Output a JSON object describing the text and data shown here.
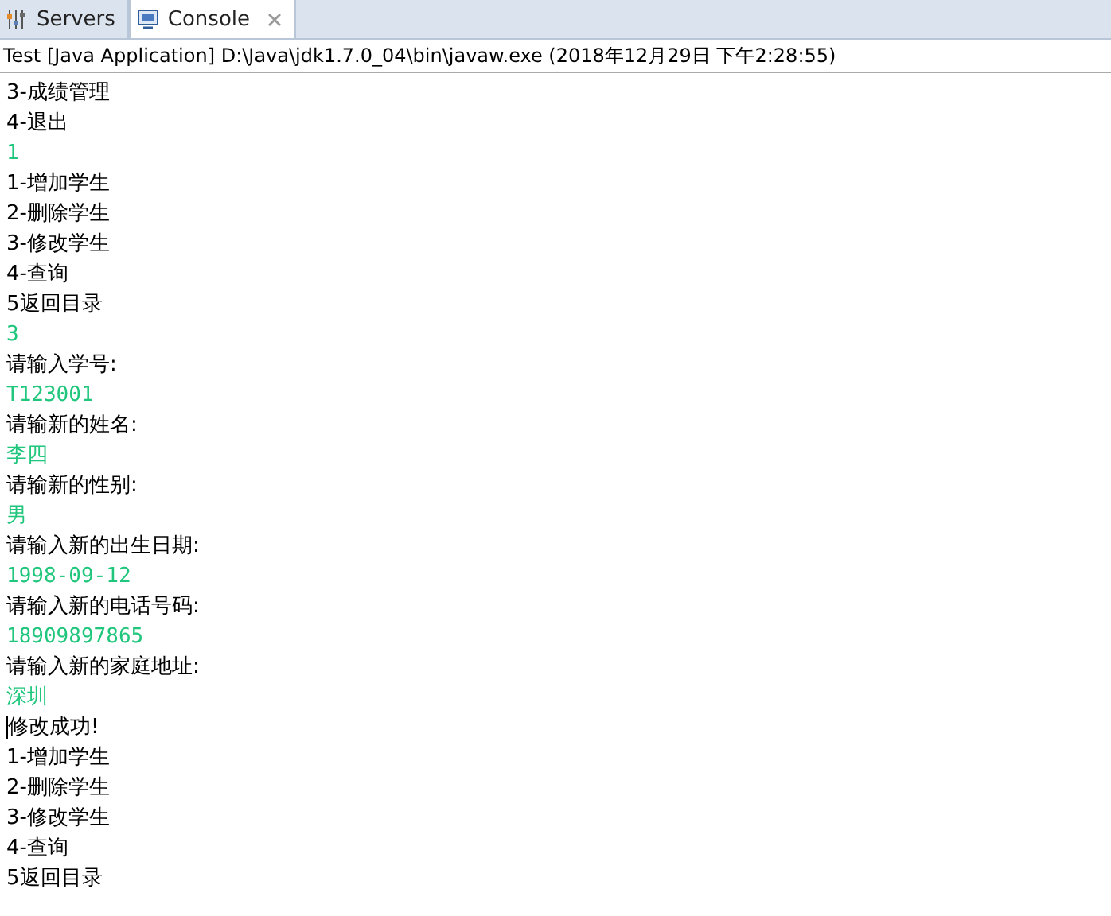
{
  "tabs": [
    {
      "label": "Servers",
      "kind": "servers",
      "selected": false,
      "closable": false
    },
    {
      "label": "Console",
      "kind": "console",
      "selected": true,
      "closable": true
    }
  ],
  "console_title": "Test [Java Application] D:\\Java\\jdk1.7.0_04\\bin\\javaw.exe (2018年12月29日 下午2:28:55)",
  "lines": [
    {
      "text": "3-成绩管理",
      "kind": "output",
      "cursor": false
    },
    {
      "text": "4-退出",
      "kind": "output",
      "cursor": false
    },
    {
      "text": "1",
      "kind": "input",
      "cursor": false
    },
    {
      "text": "1-增加学生",
      "kind": "output",
      "cursor": false
    },
    {
      "text": "2-删除学生",
      "kind": "output",
      "cursor": false
    },
    {
      "text": "3-修改学生",
      "kind": "output",
      "cursor": false
    },
    {
      "text": "4-查询",
      "kind": "output",
      "cursor": false
    },
    {
      "text": "5返回目录",
      "kind": "output",
      "cursor": false
    },
    {
      "text": "3",
      "kind": "input",
      "cursor": false
    },
    {
      "text": "请输入学号:",
      "kind": "output",
      "cursor": false
    },
    {
      "text": "T123001",
      "kind": "input",
      "cursor": false
    },
    {
      "text": "请输新的姓名:",
      "kind": "output",
      "cursor": false
    },
    {
      "text": "李四",
      "kind": "input",
      "cursor": false
    },
    {
      "text": "请输新的性别:",
      "kind": "output",
      "cursor": false
    },
    {
      "text": "男",
      "kind": "input",
      "cursor": false
    },
    {
      "text": "请输入新的出生日期:",
      "kind": "output",
      "cursor": false
    },
    {
      "text": "1998-09-12",
      "kind": "input",
      "cursor": false
    },
    {
      "text": "请输入新的电话号码:",
      "kind": "output",
      "cursor": false
    },
    {
      "text": "18909897865",
      "kind": "input",
      "cursor": false
    },
    {
      "text": "请输入新的家庭地址:",
      "kind": "output",
      "cursor": false
    },
    {
      "text": "深圳",
      "kind": "input",
      "cursor": false
    },
    {
      "text": "修改成功!",
      "kind": "output",
      "cursor": true
    },
    {
      "text": "1-增加学生",
      "kind": "output",
      "cursor": false
    },
    {
      "text": "2-删除学生",
      "kind": "output",
      "cursor": false
    },
    {
      "text": "3-修改学生",
      "kind": "output",
      "cursor": false
    },
    {
      "text": "4-查询",
      "kind": "output",
      "cursor": false
    },
    {
      "text": "5返回目录",
      "kind": "output",
      "cursor": false
    }
  ]
}
